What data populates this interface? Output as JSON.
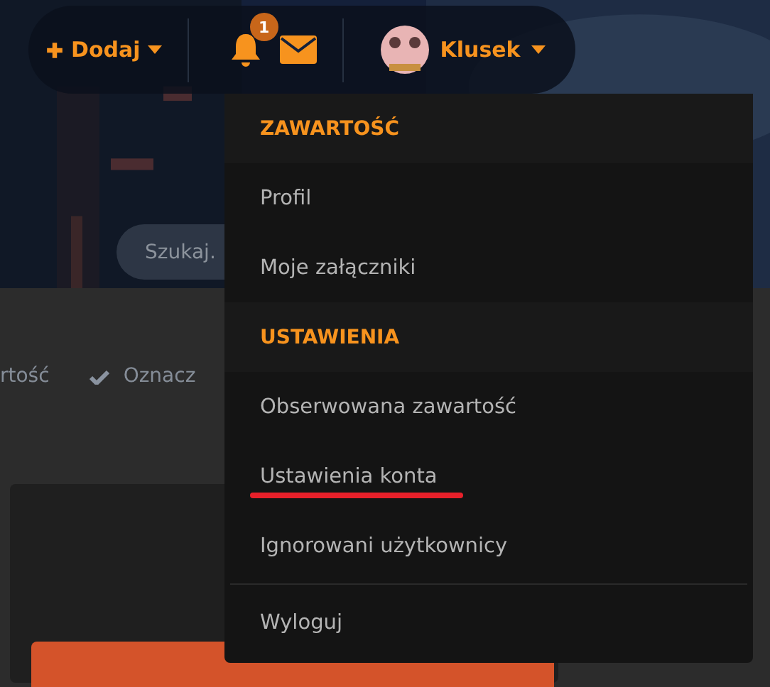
{
  "nav": {
    "add_label": "Dodaj",
    "notification_count": "1",
    "user_name": "Klusek"
  },
  "search": {
    "placeholder": "Szukaj."
  },
  "links": [
    {
      "label": "rtość",
      "kind": "plain"
    },
    {
      "label": "Oznacz",
      "kind": "check"
    }
  ],
  "menu": {
    "sections": [
      {
        "heading": "ZAWARTOŚĆ",
        "items": [
          {
            "label": "Profil",
            "underlined": false
          },
          {
            "label": "Moje załączniki",
            "underlined": false
          }
        ]
      },
      {
        "heading": "USTAWIENIA",
        "items": [
          {
            "label": "Obserwowana zawartość",
            "underlined": false
          },
          {
            "label": "Ustawienia konta",
            "underlined": true
          },
          {
            "label": "Ignorowani użytkownicy",
            "underlined": false
          }
        ]
      }
    ],
    "footer_items": [
      "Wyloguj"
    ]
  }
}
